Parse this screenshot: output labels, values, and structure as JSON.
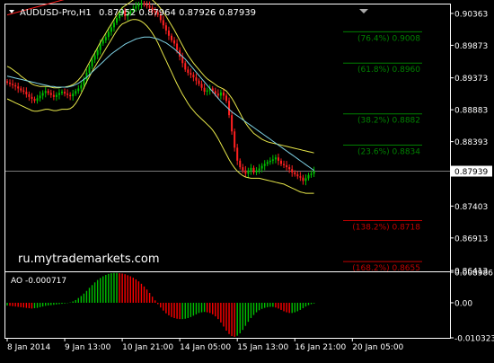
{
  "header": {
    "symbol_timeframe": "AUDUSD-Pro,H1",
    "ohlc": "0.87952 0.87964 0.87926 0.87939"
  },
  "watermark": "ru.mytrademarkets.com",
  "colors": {
    "background": "#000000",
    "grid_axes": "#ffffff",
    "candle_up": "#00c000",
    "candle_down": "#ff2020",
    "ma_yellow": "#e8e84a",
    "ma_cyan": "#7fd3e6",
    "trend_red": "#ff2020",
    "fib_green": "#008000",
    "fib_red": "#c00000",
    "ao_up": "#00c000",
    "ao_down": "#ff0000",
    "price_line": "#a0a0a0"
  },
  "chart_data": [
    {
      "type": "candlestick",
      "ylim": [
        0.864,
        0.905
      ],
      "price_ticks": [
        "0.90363",
        "0.89873",
        "0.89373",
        "0.88883",
        "0.88393",
        "0.87939",
        "0.87403",
        "0.86913",
        "0.86413"
      ],
      "price_tick_values": [
        0.90363,
        0.89873,
        0.89373,
        0.88883,
        0.88393,
        0.87939,
        0.87403,
        0.86913,
        0.86413
      ],
      "current_price": 0.87939,
      "x_ticks": [
        "8 Jan 2014",
        "9 Jan 13:00",
        "10 Jan 21:00",
        "14 Jan 05:00",
        "15 Jan 13:00",
        "16 Jan 21:00",
        "20 Jan 05:00"
      ],
      "x_tick_bars": [
        0,
        21,
        42,
        63,
        84,
        105,
        126
      ],
      "close": [
        0.893,
        0.8928,
        0.8926,
        0.8924,
        0.8921,
        0.8918,
        0.8916,
        0.8912,
        0.8908,
        0.8905,
        0.8902,
        0.8906,
        0.891,
        0.8914,
        0.8917,
        0.8914,
        0.8911,
        0.8908,
        0.8911,
        0.8914,
        0.8916,
        0.8913,
        0.8911,
        0.8909,
        0.8913,
        0.8917,
        0.8921,
        0.8926,
        0.8935,
        0.8945,
        0.8955,
        0.8965,
        0.8972,
        0.898,
        0.899,
        0.8995,
        0.9,
        0.9008,
        0.9015,
        0.9022,
        0.9029,
        0.9036,
        0.904,
        0.9032,
        0.9036,
        0.904,
        0.9044,
        0.9047,
        0.905,
        0.9052,
        0.905,
        0.9048,
        0.9045,
        0.904,
        0.9038,
        0.9034,
        0.9026,
        0.9018,
        0.901,
        0.9002,
        0.8995,
        0.899,
        0.898,
        0.897,
        0.896,
        0.895,
        0.8945,
        0.8942,
        0.8938,
        0.8933,
        0.8928,
        0.8922,
        0.8916,
        0.8918,
        0.8921,
        0.8917,
        0.8913,
        0.891,
        0.8915,
        0.891,
        0.8902,
        0.888,
        0.8855,
        0.883,
        0.881,
        0.88,
        0.8795,
        0.879,
        0.8795,
        0.8799,
        0.8792,
        0.8795,
        0.8798,
        0.8802,
        0.8805,
        0.8808,
        0.881,
        0.8812,
        0.8815,
        0.881,
        0.8805,
        0.8803,
        0.88,
        0.8797,
        0.8792,
        0.8789,
        0.8786,
        0.8784,
        0.8779,
        0.8783,
        0.8788,
        0.879,
        0.8794
      ],
      "series": [
        {
          "color_key": "ma_yellow",
          "values": [
            0.8955,
            0.8953,
            0.895,
            0.8947,
            0.8944,
            0.894,
            0.8937,
            0.8934,
            0.8931,
            0.8928,
            0.8926,
            0.8925,
            0.8924,
            0.8924,
            0.8924,
            0.8924,
            0.8923,
            0.8922,
            0.8922,
            0.8922,
            0.8923,
            0.8923,
            0.8924,
            0.8925,
            0.8927,
            0.893,
            0.8934,
            0.8939,
            0.8945,
            0.8953,
            0.8961,
            0.8969,
            0.8976,
            0.8984,
            0.8992,
            0.8999,
            0.9006,
            0.9013,
            0.902,
            0.9027,
            0.9034,
            0.904,
            0.9045,
            0.9048,
            0.9051,
            0.9054,
            0.9057,
            0.9059,
            0.9061,
            0.9063,
            0.9063,
            0.9062,
            0.906,
            0.9057,
            0.9053,
            0.9049,
            0.9044,
            0.9038,
            0.9032,
            0.9025,
            0.9018,
            0.9011,
            0.9003,
            0.8995,
            0.8987,
            0.8979,
            0.8972,
            0.8966,
            0.896,
            0.8955,
            0.895,
            0.8945,
            0.894,
            0.8936,
            0.8933,
            0.893,
            0.8927,
            0.8924,
            0.8922,
            0.892,
            0.8917,
            0.8912,
            0.8906,
            0.8899,
            0.8891,
            0.8883,
            0.8875,
            0.8868,
            0.8862,
            0.8857,
            0.8852,
            0.8849,
            0.8846,
            0.8843,
            0.8841,
            0.8839,
            0.8838,
            0.8837,
            0.8836,
            0.8835,
            0.8834,
            0.8833,
            0.8832,
            0.8831,
            0.883,
            0.8829,
            0.8828,
            0.8827,
            0.8826,
            0.8825,
            0.8824,
            0.8823,
            0.8822
          ]
        },
        {
          "color_key": "ma_yellow",
          "values": [
            0.8905,
            0.8903,
            0.8901,
            0.8899,
            0.8897,
            0.8895,
            0.8893,
            0.8891,
            0.8889,
            0.8887,
            0.8886,
            0.8886,
            0.8887,
            0.8888,
            0.8889,
            0.8889,
            0.8888,
            0.8887,
            0.8887,
            0.8888,
            0.8889,
            0.8889,
            0.8889,
            0.889,
            0.8893,
            0.8898,
            0.8905,
            0.8913,
            0.8922,
            0.8931,
            0.8939,
            0.8947,
            0.8954,
            0.8961,
            0.8968,
            0.8975,
            0.8982,
            0.8989,
            0.8996,
            0.9003,
            0.901,
            0.9016,
            0.902,
            0.9022,
            0.9024,
            0.9026,
            0.9027,
            0.9027,
            0.9026,
            0.9024,
            0.9021,
            0.9017,
            0.9012,
            0.9006,
            0.8999,
            0.8991,
            0.8982,
            0.8973,
            0.8964,
            0.8955,
            0.8946,
            0.8937,
            0.8928,
            0.892,
            0.8912,
            0.8905,
            0.8898,
            0.8892,
            0.8887,
            0.8882,
            0.8878,
            0.8874,
            0.887,
            0.8866,
            0.8862,
            0.8857,
            0.8851,
            0.8844,
            0.8836,
            0.8828,
            0.882,
            0.8812,
            0.8805,
            0.8799,
            0.8794,
            0.879,
            0.8787,
            0.8785,
            0.8784,
            0.8783,
            0.8783,
            0.8783,
            0.8783,
            0.8782,
            0.8781,
            0.878,
            0.8779,
            0.8778,
            0.8777,
            0.8776,
            0.8775,
            0.8774,
            0.8772,
            0.877,
            0.8768,
            0.8766,
            0.8764,
            0.8762,
            0.8761,
            0.876,
            0.876,
            0.876,
            0.876
          ]
        },
        {
          "color_key": "ma_cyan",
          "values": [
            0.894,
            0.8939,
            0.8938,
            0.8937,
            0.8936,
            0.8935,
            0.8934,
            0.8933,
            0.8932,
            0.8931,
            0.893,
            0.8929,
            0.8928,
            0.8927,
            0.8926,
            0.8925,
            0.8924,
            0.8924,
            0.8923,
            0.8923,
            0.8923,
            0.8923,
            0.8923,
            0.8924,
            0.8925,
            0.8927,
            0.8929,
            0.8932,
            0.8935,
            0.8938,
            0.8942,
            0.8946,
            0.895,
            0.8954,
            0.8958,
            0.8962,
            0.8966,
            0.897,
            0.8974,
            0.8977,
            0.898,
            0.8983,
            0.8986,
            0.8989,
            0.8991,
            0.8993,
            0.8995,
            0.8997,
            0.8998,
            0.8999,
            0.9,
            0.9,
            0.9,
            0.8999,
            0.8998,
            0.8997,
            0.8995,
            0.8993,
            0.8991,
            0.8988,
            0.8985,
            0.8982,
            0.8978,
            0.8974,
            0.897,
            0.8966,
            0.8961,
            0.8956,
            0.8951,
            0.8946,
            0.8941,
            0.8936,
            0.8931,
            0.8926,
            0.8921,
            0.8916,
            0.8911,
            0.8906,
            0.8901,
            0.8897,
            0.8893,
            0.8889,
            0.8885,
            0.8882,
            0.8879,
            0.8876,
            0.8873,
            0.887,
            0.8867,
            0.8864,
            0.8861,
            0.8858,
            0.8855,
            0.8852,
            0.8849,
            0.8846,
            0.8843,
            0.884,
            0.8837,
            0.8834,
            0.8831,
            0.8828,
            0.8825,
            0.8822,
            0.8819,
            0.8816,
            0.8813,
            0.881,
            0.8807,
            0.8804,
            0.8801,
            0.8798,
            0.8795
          ]
        }
      ],
      "trendline": [
        {
          "bar": 0,
          "price": 0.9034
        },
        {
          "bar": 30,
          "price": 0.9068
        }
      ],
      "fibonacci": [
        {
          "label": "(76.4%) 0.9008",
          "price": 0.9008,
          "color_key": "fib_green"
        },
        {
          "label": "(61.8%) 0.8960",
          "price": 0.896,
          "color_key": "fib_green"
        },
        {
          "label": "(38.2%) 0.8882",
          "price": 0.8882,
          "color_key": "fib_green"
        },
        {
          "label": "(23.6%) 0.8834",
          "price": 0.8834,
          "color_key": "fib_green"
        },
        {
          "label": "(138.2%) 0.8718",
          "price": 0.8718,
          "color_key": "fib_red"
        },
        {
          "label": "(168.2%) 0.8655",
          "price": 0.8655,
          "color_key": "fib_red"
        }
      ]
    },
    {
      "type": "bar",
      "title": "AO -0.000717",
      "ylim": [
        -0.010323,
        0.008986
      ],
      "y_ticks": [
        "0.008986",
        "0.00",
        "-0.010323"
      ],
      "y_tick_values": [
        0.008986,
        0.0,
        -0.010323
      ],
      "values": [
        -0.0008,
        -0.0009,
        -0.001,
        -0.0011,
        -0.0012,
        -0.0013,
        -0.0014,
        -0.0015,
        -0.0016,
        -0.0017,
        -0.0016,
        -0.0015,
        -0.0013,
        -0.0011,
        -0.0009,
        -0.0008,
        -0.0007,
        -0.0006,
        -0.0005,
        -0.0004,
        -0.0003,
        -0.0002,
        -0.0001,
        0.0001,
        0.0004,
        0.0008,
        0.0014,
        0.002,
        0.0027,
        0.0035,
        0.0044,
        0.0052,
        0.006,
        0.0067,
        0.0073,
        0.0078,
        0.0082,
        0.0085,
        0.0087,
        0.0088,
        0.0088,
        0.0087,
        0.0086,
        0.0084,
        0.0081,
        0.0078,
        0.0074,
        0.0069,
        0.0063,
        0.0056,
        0.0048,
        0.0039,
        0.0029,
        0.0018,
        0.0007,
        -0.0004,
        -0.0014,
        -0.0023,
        -0.0031,
        -0.0037,
        -0.0042,
        -0.0045,
        -0.0047,
        -0.0048,
        -0.0048,
        -0.0047,
        -0.0045,
        -0.0042,
        -0.0038,
        -0.0034,
        -0.003,
        -0.0028,
        -0.0027,
        -0.0028,
        -0.003,
        -0.0034,
        -0.004,
        -0.0048,
        -0.0058,
        -0.007,
        -0.0082,
        -0.0092,
        -0.0098,
        -0.01,
        -0.0097,
        -0.009,
        -0.008,
        -0.0068,
        -0.0056,
        -0.0045,
        -0.0036,
        -0.0028,
        -0.0022,
        -0.0018,
        -0.0015,
        -0.0013,
        -0.0012,
        -0.0012,
        -0.0014,
        -0.0017,
        -0.0021,
        -0.0025,
        -0.0028,
        -0.003,
        -0.003,
        -0.0028,
        -0.0025,
        -0.0021,
        -0.0016,
        -0.0011,
        -0.0007,
        -0.0004,
        -0.0002
      ]
    }
  ]
}
